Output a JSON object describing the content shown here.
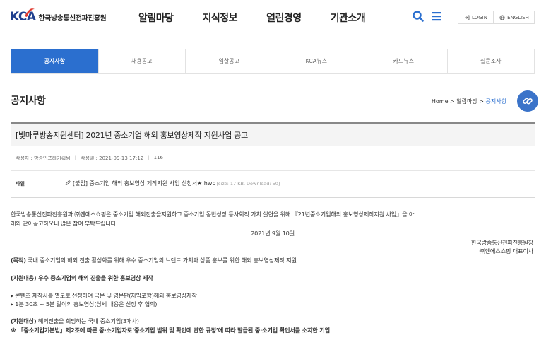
{
  "header": {
    "logo_text": "KCA",
    "org_name": "한국방송통신전파진흥원",
    "nav": [
      "알림마당",
      "지식정보",
      "열린경영",
      "기관소개"
    ],
    "login_label": "LOGIN",
    "english_label": "ENGLISH",
    "brand_color": "#1f3f8e",
    "accent_color": "#2b6fcf"
  },
  "subnav": {
    "tabs": [
      "공지사항",
      "채용공고",
      "입찰공고",
      "KCA뉴스",
      "카드뉴스",
      "설문조사"
    ],
    "active": "공지사항"
  },
  "page": {
    "title": "공지사항",
    "breadcrumb": [
      "Home",
      "알림마당",
      "공지사항"
    ]
  },
  "article": {
    "title": "[빛마루방송지원센터] 2021년 중소기업 해외 홍보영상제작 지원사업 공고",
    "author": "작성자 : 방송인프라기획팀",
    "date": "작성일 : 2021-09-13 17:12",
    "views": "116",
    "file_label": "파일",
    "file_name": "[붙임] 중소기업 해외 홍보영상 제작지원 사업 신청서★.hwp",
    "file_meta": "[size: 17 KB, Download: 50]"
  },
  "body": {
    "intro1": "한국방송통신전파진흥원과 ㈜엔에스쇼핑은 중소기업 해외진출을지원하고 중소기업 동반성장 등사회적 가치 실현을 위해 『21년중소기업해외 홍보영상제작지원 사업』을 아",
    "intro2": "래와 같이공고하오니 많은 참여 부탁드립니다.",
    "date": "2021년 9월 10일",
    "sign1": "한국방송통신전파진흥원장",
    "sign2": "㈜엔에스쇼핑 대표이사",
    "purpose_label": "(목적)",
    "purpose": " 국내 중소기업의 해외 진출 활성화를 위해 우수 중소기업의 브랜드 가치와 상품 홍보를 위한 해외 홍보영상제작 지원",
    "content_heading": "(지원내용) 우수 중소기업의 해외 진출을 위한 홍보영상 제작",
    "bullet1": "▸ 콘텐츠 제작사를 별도로 선정하여 국문 및 영문판(자막포함)해외 홍보영상제작",
    "bullet2": "▸ 1분 30초 ~ 5분 길이의 홍보영상(상세 내용은 선정 후 협의)",
    "target_label": "(지원대상)",
    "target": " 해외진출을 희망하는 국내 중소기업(3개사)",
    "note": "※ 「중소기업기본법」제2조에 따른 중·소기업자로‘중소기업 범위 및 확인에 관한 규정’에 따라 발급된 중·소기업 확인서를 소지한 기업"
  }
}
